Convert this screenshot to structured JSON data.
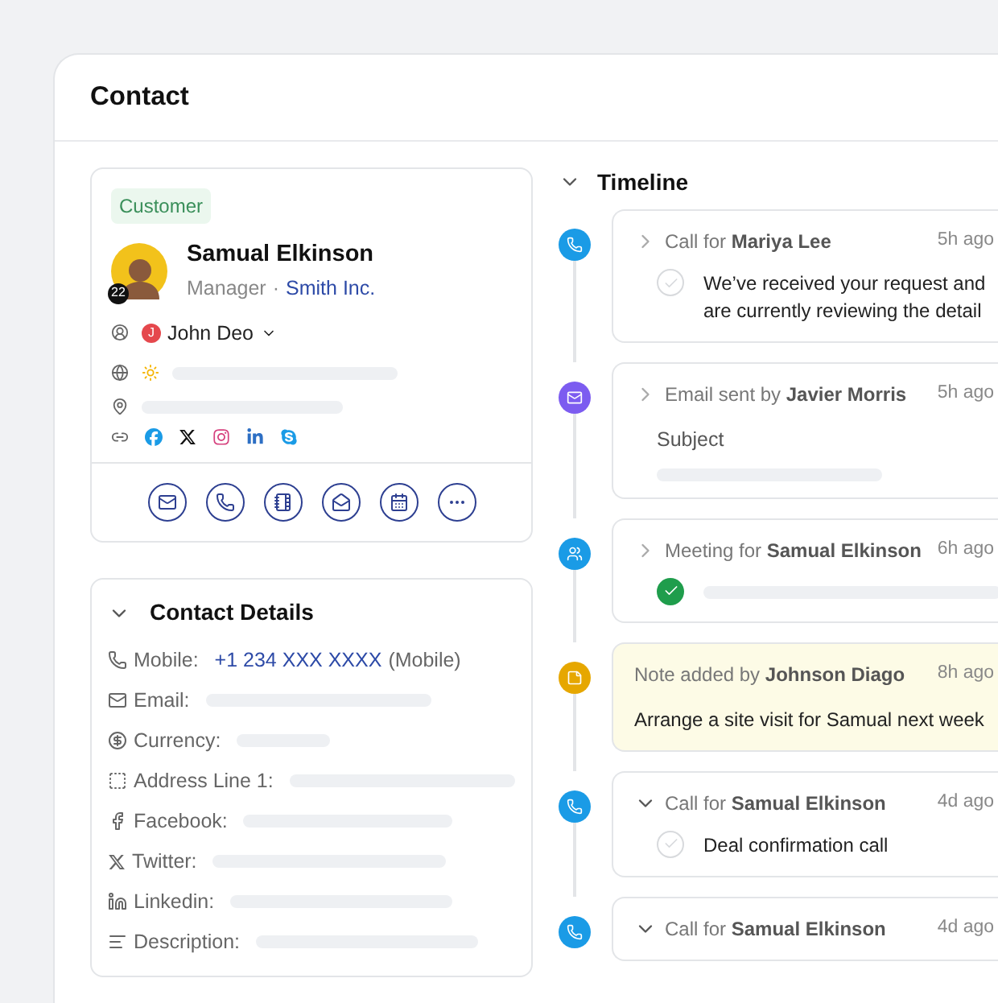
{
  "page": {
    "title": "Contact"
  },
  "profile": {
    "tag": "Customer",
    "name": "Samual Elkinson",
    "role": "Manager",
    "separator": "·",
    "company": "Smith Inc.",
    "avatar_badge": "22",
    "owner": {
      "initial": "J",
      "name": "John Deo",
      "color": "#e5484d"
    }
  },
  "details": {
    "title": "Contact Details",
    "expanded": true,
    "fields": [
      {
        "label": "Mobile:",
        "value": "+1 234 XXX XXXX",
        "suffix": "(Mobile)"
      },
      {
        "label": "Email:"
      },
      {
        "label": "Currency:"
      },
      {
        "label": "Address Line 1:"
      },
      {
        "label": "Facebook:"
      },
      {
        "label": "Twitter:"
      },
      {
        "label": "Linkedin:"
      },
      {
        "label": "Description:"
      }
    ]
  },
  "timeline": {
    "title": "Timeline",
    "expanded": true,
    "items": [
      {
        "kind": "call",
        "color": "#1a9be6",
        "title": "Call for **Mariya Lee**",
        "time": "5h ago",
        "expanded": false,
        "body": {
          "kind": "task",
          "done": false,
          "text": "We’ve received your request and are currently reviewing the detail"
        }
      },
      {
        "kind": "email",
        "color": "#7c5cf0",
        "title": "Email sent by **Javier Morris**",
        "time": "5h ago",
        "expanded": false,
        "body": {
          "kind": "subject",
          "label": "Subject"
        }
      },
      {
        "kind": "meeting",
        "color": "#1a9be6",
        "title": "Meeting for **Samual Elkinson**",
        "time": "6h ago",
        "expanded": false,
        "body": {
          "kind": "task",
          "done": true
        }
      },
      {
        "kind": "note",
        "color": "#e6a700",
        "title": "Note added by **Johnson Diago**",
        "time": "8h ago",
        "body": {
          "kind": "note",
          "text": "Arrange a site visit for Samual next week"
        }
      },
      {
        "kind": "call",
        "color": "#1a9be6",
        "title": "Call for **Samual Elkinson**",
        "time": "4d ago",
        "expanded": true,
        "body": {
          "kind": "task",
          "done": false,
          "text": "Deal confirmation call"
        }
      },
      {
        "kind": "call",
        "color": "#1a9be6",
        "title": "Call for **Samual Elkinson**",
        "time": "4d ago",
        "expanded": true
      }
    ]
  }
}
